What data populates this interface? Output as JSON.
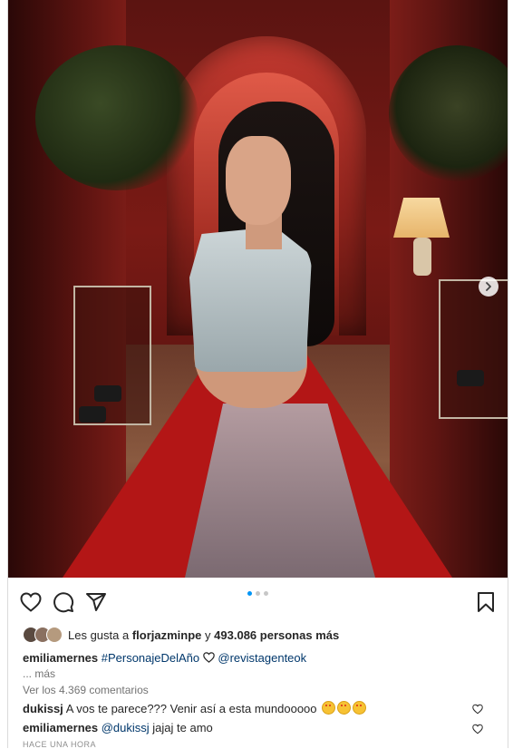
{
  "post": {
    "likes": {
      "prefix": "Les gusta a",
      "user": "florjazminpe",
      "connector": "y",
      "others": "493.086 personas más"
    },
    "caption": {
      "author": "emiliamernes",
      "hashtag": "#PersonajeDelAño",
      "mention": "@revistagenteok",
      "more": "... más"
    },
    "view_all_comments": "Ver los 4.369 comentarios",
    "comments": [
      {
        "author": "dukissj",
        "text": "A vos te parece??? Venir así a esta mundooooo"
      },
      {
        "author": "emiliamernes",
        "mention": "@dukissj",
        "text": "jajaj te amo"
      }
    ],
    "timestamp": "HACE UNA HORA",
    "carousel": {
      "current": 1,
      "total": 3
    }
  },
  "icons": {
    "like": "heart-icon",
    "comment": "comment-icon",
    "share": "share-icon",
    "save": "bookmark-icon",
    "next": "chevron-right-icon"
  },
  "colors": {
    "link": "#00376b",
    "active_dot": "#0095f6",
    "secondary_text": "#737373"
  }
}
